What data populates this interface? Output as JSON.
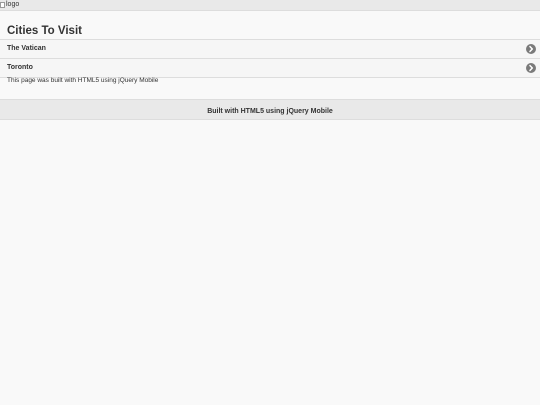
{
  "header": {
    "logo_alt": "logo",
    "logo_icon": "broken-image-icon"
  },
  "main": {
    "title": "Cities To Visit",
    "cities": [
      {
        "label": "The Vatican",
        "icon": "chevron-right-circle-icon"
      },
      {
        "label": "Toronto",
        "icon": "chevron-right-circle-icon"
      }
    ],
    "info": "This page was built with HTML5 using jQuery Mobile"
  },
  "footer": {
    "text": "Built with HTML5 using jQuery Mobile"
  },
  "colors": {
    "background": "#f9f9f9",
    "bar": "#e9e9e9",
    "border": "#dddddd",
    "icon": "#7a7a7a",
    "text": "#333333"
  }
}
